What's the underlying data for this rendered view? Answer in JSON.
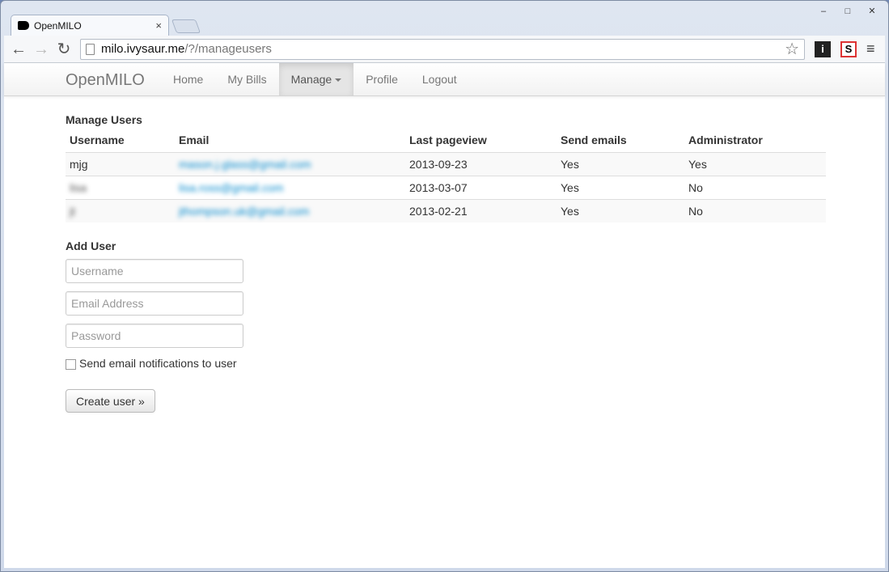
{
  "browser": {
    "tab_title": "OpenMILO",
    "tab_close": "×",
    "url_host": "milo.ivysaur.me",
    "url_path": "/?/manageusers",
    "win_minimize": "‒",
    "win_restore": "□",
    "win_close": "✕",
    "back": "←",
    "forward": "→",
    "reload": "↻",
    "star": "☆",
    "ext_info": "i",
    "ext_s": "S",
    "menu": "≡"
  },
  "navbar": {
    "brand": "OpenMILO",
    "links": [
      "Home",
      "My Bills",
      "Manage",
      "Profile",
      "Logout"
    ]
  },
  "manage_users": {
    "heading": "Manage Users",
    "columns": [
      "Username",
      "Email",
      "Last pageview",
      "Send emails",
      "Administrator"
    ],
    "rows": [
      {
        "username": "mjg",
        "email": "mason.j.glass@gmail.com",
        "last_pageview": "2013-09-23",
        "send_emails": "Yes",
        "administrator": "Yes"
      },
      {
        "username": "lisa",
        "email": "lisa.ross@gmail.com",
        "last_pageview": "2013-03-07",
        "send_emails": "Yes",
        "administrator": "No"
      },
      {
        "username": "jt",
        "email": "jthompson.uk@gmail.com",
        "last_pageview": "2013-02-21",
        "send_emails": "Yes",
        "administrator": "No"
      }
    ]
  },
  "add_user": {
    "heading": "Add User",
    "username_placeholder": "Username",
    "email_placeholder": "Email Address",
    "password_placeholder": "Password",
    "notify_label": "Send email notifications to user",
    "submit_label": "Create user »"
  }
}
